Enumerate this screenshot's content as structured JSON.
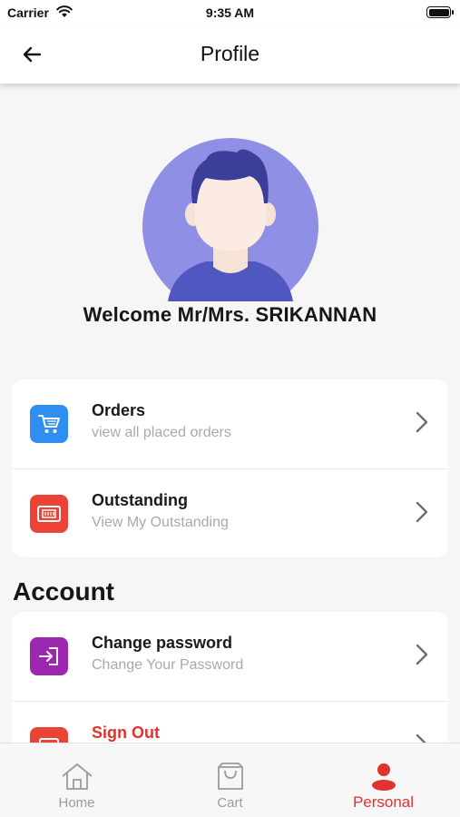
{
  "status_bar": {
    "carrier": "Carrier",
    "time": "9:35 AM"
  },
  "header": {
    "title": "Profile"
  },
  "profile": {
    "welcome": "Welcome Mr/Mrs. SRIKANNAN"
  },
  "menu": {
    "items": [
      {
        "title": "Orders",
        "subtitle": "view all placed orders",
        "icon": "cart-icon",
        "color": "#2f8ff0"
      },
      {
        "title": "Outstanding",
        "subtitle": "View My Outstanding",
        "icon": "ticket-icon",
        "color": "#eb4336"
      }
    ]
  },
  "account": {
    "title": "Account",
    "items": [
      {
        "title": "Change password",
        "subtitle": "Change Your Password",
        "icon": "login-icon",
        "color": "#9c27b0"
      },
      {
        "title": "Sign Out",
        "icon": "signout-icon",
        "color": "#eb4336"
      }
    ]
  },
  "tabs": [
    {
      "label": "Home",
      "icon": "home-icon"
    },
    {
      "label": "Cart",
      "icon": "bag-icon"
    },
    {
      "label": "Personal",
      "icon": "person-icon",
      "active": true
    }
  ],
  "colors": {
    "accent": "#e1322d",
    "avatar_bg": "#8f8fe6",
    "hair": "#3b3f9a",
    "shirt": "#5057c0"
  }
}
